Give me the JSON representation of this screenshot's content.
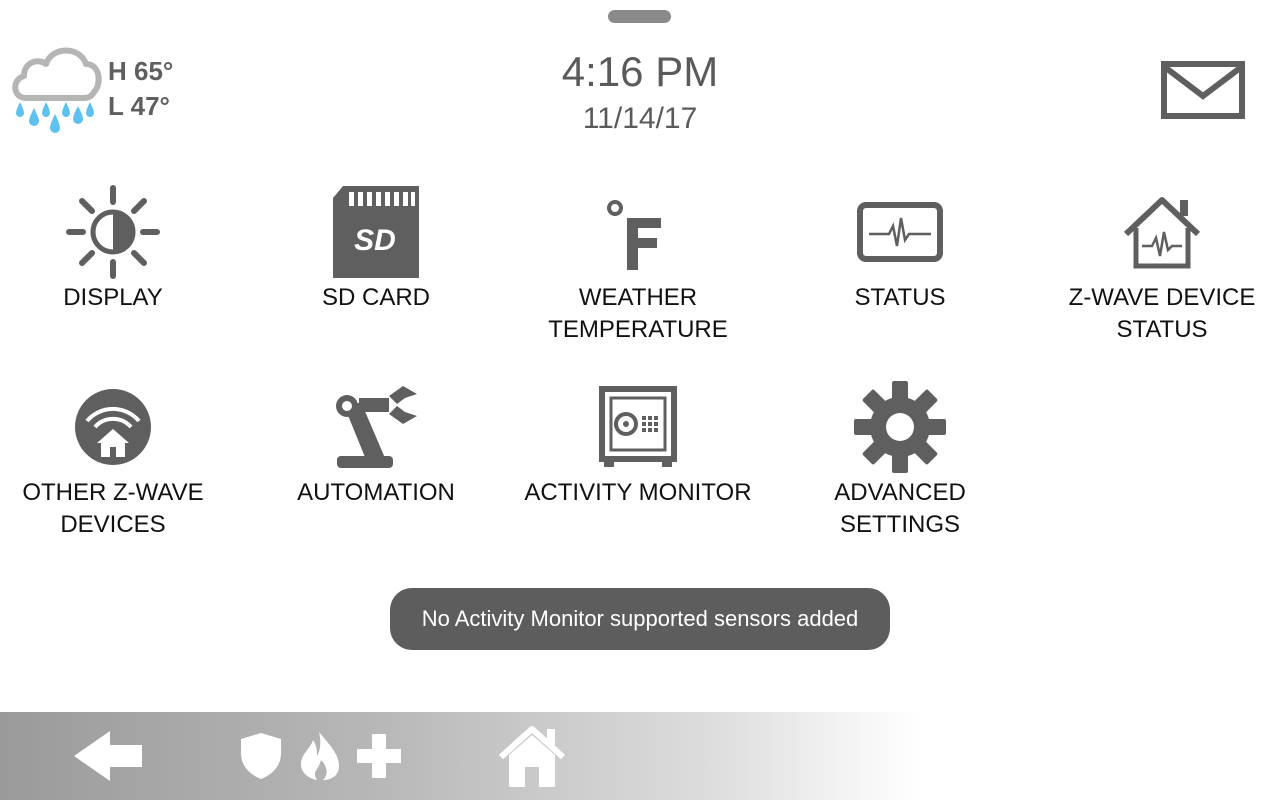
{
  "weather": {
    "icon": "rain-cloud-icon",
    "high": "H 65°",
    "low": "L 47°"
  },
  "clock": {
    "time": "4:16 PM",
    "date": "11/14/17"
  },
  "header": {
    "mail_icon": "mail-icon"
  },
  "tiles": [
    {
      "label": "DISPLAY",
      "icon": "brightness-icon"
    },
    {
      "label": "SD CARD",
      "icon": "sd-card-icon"
    },
    {
      "label": "WEATHER TEMPERATURE",
      "icon": "fahrenheit-icon"
    },
    {
      "label": "STATUS",
      "icon": "tablet-heartbeat-icon"
    },
    {
      "label": "Z-WAVE DEVICE STATUS",
      "icon": "house-heartbeat-icon"
    },
    {
      "label": "OTHER Z-WAVE DEVICES",
      "icon": "wireless-home-icon"
    },
    {
      "label": "AUTOMATION",
      "icon": "robot-arm-icon"
    },
    {
      "label": "ACTIVITY MONITOR",
      "icon": "safe-icon"
    },
    {
      "label": "ADVANCED SETTINGS",
      "icon": "gear-icon"
    }
  ],
  "toast": {
    "message": "No Activity Monitor supported sensors added"
  },
  "bottom_bar": {
    "back_icon": "back-arrow-icon",
    "emergency_icons": [
      "shield-icon",
      "flame-icon",
      "medical-cross-icon"
    ],
    "home_icon": "home-icon"
  },
  "colors": {
    "icon_gray": "#5f5f5f",
    "rain_blue": "#5ec2f0",
    "toast_bg": "#5d5d5d"
  }
}
